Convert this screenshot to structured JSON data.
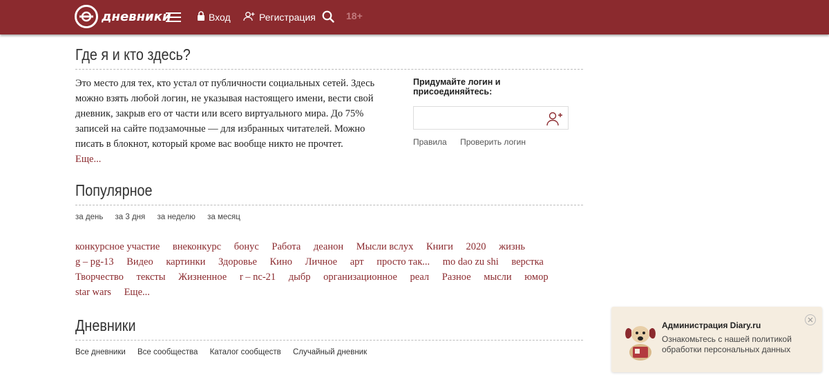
{
  "header": {
    "logo_text": "дневники",
    "login": "Вход",
    "register": "Регистрация",
    "age": "18+"
  },
  "about": {
    "title": "Где я и кто здесь?",
    "text": "Это место для тех, кто устал от публичности социальных сетей. Здесь можно взять любой логин, не указывая настоящего имени, вести свой дневник, закрыв его от части или всего виртуального мира. До 75% записей на сайте подзамочные — для избранных читателей. Можно писать в блокнот, который кроме вас вообще никто не прочтет.",
    "more": "Еще..."
  },
  "join": {
    "title": "Придумайте логин и присоединяйтесь:",
    "input_value": "",
    "rules": "Правила",
    "check": "Проверить логин"
  },
  "popular": {
    "title": "Популярное",
    "periods": [
      "за день",
      "за 3 дня",
      "за неделю",
      "за месяц"
    ],
    "tags": [
      "конкурсное участие",
      "внеконкурс",
      "бонус",
      "Работа",
      "деанон",
      "Мысли вслух",
      "Книги",
      "2020",
      "жизнь",
      "g – pg-13",
      "Видео",
      "картинки",
      "Здоровье",
      "Кино",
      "Личное",
      "арт",
      "просто так...",
      "mo dao zu shi",
      "верстка",
      "Творчество",
      "тексты",
      "Жизненное",
      "r – nc-21",
      "дыбр",
      "организационное",
      "реал",
      "Разное",
      "мысли",
      "юмор",
      "star wars"
    ],
    "more": "Еще..."
  },
  "diaries": {
    "title": "Дневники",
    "links": [
      "Все дневники",
      "Все сообщества",
      "Каталог сообществ",
      "Случайный дневник"
    ]
  },
  "toast": {
    "title": "Администрация Diary.ru",
    "text": "Ознакомьтесь с нашей политикой обработки персональных данных"
  },
  "colors": {
    "brand": "#8b2a2e",
    "toast_bg": "#f5ede0"
  },
  "icons": [
    "logo-icon",
    "menu-icon",
    "lock-icon",
    "user-plus-icon",
    "search-icon",
    "close-icon",
    "dog-avatar-icon"
  ]
}
